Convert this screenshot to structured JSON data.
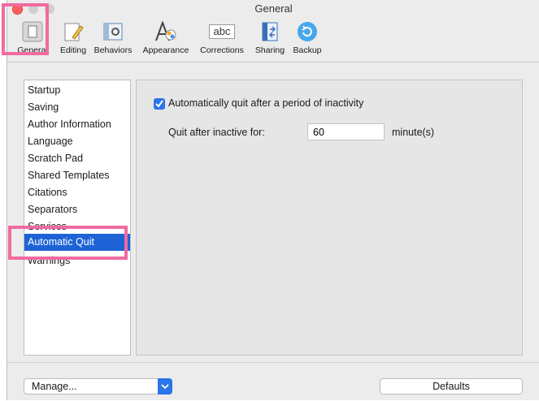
{
  "window": {
    "title": "General"
  },
  "toolbar": {
    "items": [
      {
        "label": "General",
        "icon": "general-icon"
      },
      {
        "label": "Editing",
        "icon": "editing-icon"
      },
      {
        "label": "Behaviors",
        "icon": "behaviors-icon"
      },
      {
        "label": "Appearance",
        "icon": "appearance-icon"
      },
      {
        "label": "Corrections",
        "icon": "corrections-icon",
        "icon_text": "abc"
      },
      {
        "label": "Sharing",
        "icon": "sharing-icon"
      },
      {
        "label": "Backup",
        "icon": "backup-icon"
      }
    ]
  },
  "sidebar": {
    "items": [
      {
        "label": "Startup"
      },
      {
        "label": "Saving"
      },
      {
        "label": "Author Information"
      },
      {
        "label": "Language"
      },
      {
        "label": "Scratch Pad"
      },
      {
        "label": "Shared Templates"
      },
      {
        "label": "Citations"
      },
      {
        "label": "Separators"
      },
      {
        "label": "Services"
      },
      {
        "label": "Automatic Quit",
        "selected": true
      },
      {
        "label": "Warnings"
      }
    ]
  },
  "panel": {
    "auto_quit_label": "Automatically quit after a period of inactivity",
    "auto_quit_checked": true,
    "quit_after_label": "Quit after inactive for:",
    "quit_after_value": "60",
    "unit_label": "minute(s)"
  },
  "bottom": {
    "manage_label": "Manage...",
    "defaults_label": "Defaults"
  },
  "colors": {
    "accent": "#2a75e8",
    "selection": "#1e63d6",
    "highlight": "#f06ba0"
  }
}
